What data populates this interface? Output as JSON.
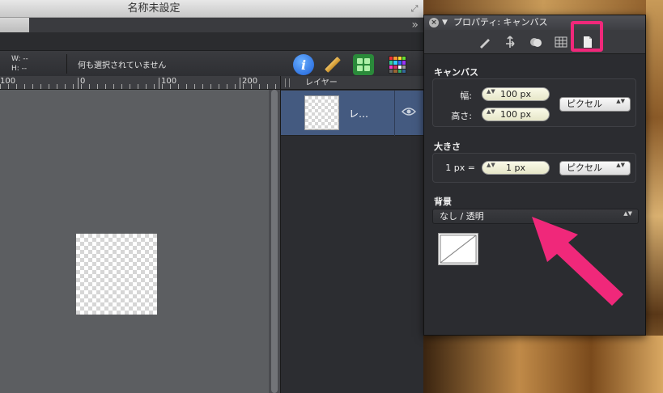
{
  "document": {
    "title": "名称未設定",
    "overflow_glyph": "»",
    "fullscreen_glyph": "⤢"
  },
  "infobar": {
    "w_label": "W: --",
    "h_label": "H: --",
    "selection_status": "何も選択されていません",
    "info_glyph": "i"
  },
  "ruler": {
    "labels": [
      "100",
      "0",
      "100",
      "200"
    ]
  },
  "layers": {
    "header": "レイヤー",
    "items": [
      {
        "name": "レ…",
        "visible": true
      }
    ]
  },
  "properties": {
    "title": "プロパティ: キャンバス",
    "close_glyph": "×",
    "disclose_glyph": "▼",
    "canvas_section": "キャンバス",
    "width_label": "幅:",
    "width_value": "100 px",
    "height_label": "高さ:",
    "height_value": "100 px",
    "unit_value": "ピクセル",
    "size_section": "大きさ",
    "scale_label": "1 px =",
    "scale_value": "1 px",
    "scale_unit": "ピクセル",
    "background_section": "背景",
    "background_value": "なし / 透明",
    "stepper_glyph": "▲▼"
  },
  "colors": {
    "highlight": "#f0287a",
    "layer_selected": "#445a80",
    "panel_bg": "#2b2c30"
  }
}
